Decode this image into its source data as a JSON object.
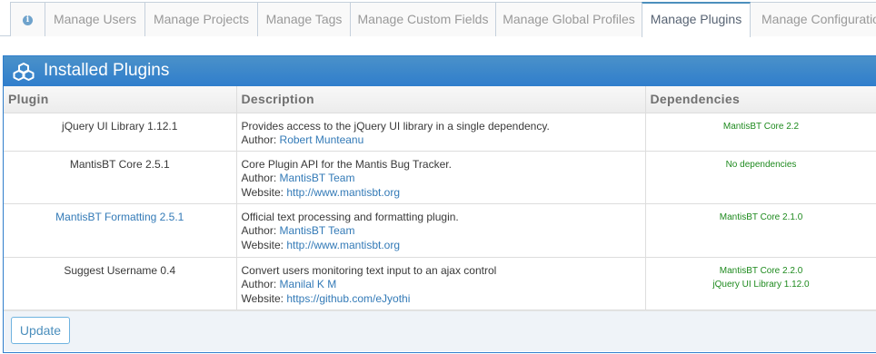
{
  "tabs": [
    {
      "label": "",
      "icon": "info-icon"
    },
    {
      "label": "Manage Users"
    },
    {
      "label": "Manage Projects"
    },
    {
      "label": "Manage Tags"
    },
    {
      "label": "Manage Custom Fields"
    },
    {
      "label": "Manage Global Profiles"
    },
    {
      "label": "Manage Plugins",
      "active": true
    },
    {
      "label": "Manage Configuration"
    }
  ],
  "widget": {
    "title": "Installed Plugins",
    "icon": "cubes-icon"
  },
  "table": {
    "headers": [
      "Plugin",
      "Description",
      "Dependencies"
    ],
    "rows": [
      {
        "name": "jQuery UI Library 1.12.1",
        "description": "Provides access to the jQuery UI library in a single dependency.",
        "author_label": "Author:",
        "author": "Robert Munteanu",
        "dependencies": [
          "MantisBT Core 2.2"
        ]
      },
      {
        "name": "MantisBT Core 2.5.1",
        "description": "Core Plugin API for the Mantis Bug Tracker.",
        "author_label": "Author:",
        "author": "MantisBT Team",
        "website_label": "Website:",
        "website": "http://www.mantisbt.org",
        "dependencies": [
          "No dependencies"
        ]
      },
      {
        "name": "MantisBT Formatting 2.5.1",
        "description": "Official text processing and formatting plugin.",
        "author_label": "Author:",
        "author": "MantisBT Team",
        "website_label": "Website:",
        "website": "http://www.mantisbt.org",
        "dependencies": [
          "MantisBT Core 2.1.0"
        ]
      },
      {
        "name": "Suggest Username 0.4",
        "description": "Convert users monitoring text input to an ajax control",
        "author_label": "Author:",
        "author": "Manilal K M",
        "website_label": "Website:",
        "website": "https://github.com/eJyothi",
        "dependencies": [
          "MantisBT Core 2.2.0",
          "jQuery UI Library 1.12.0"
        ]
      }
    ]
  },
  "footer": {
    "update_label": "Update"
  },
  "colors": {
    "header_blue": "#307ecc",
    "link_blue": "#337ab7",
    "dependency_green": "#1e8a1e"
  }
}
